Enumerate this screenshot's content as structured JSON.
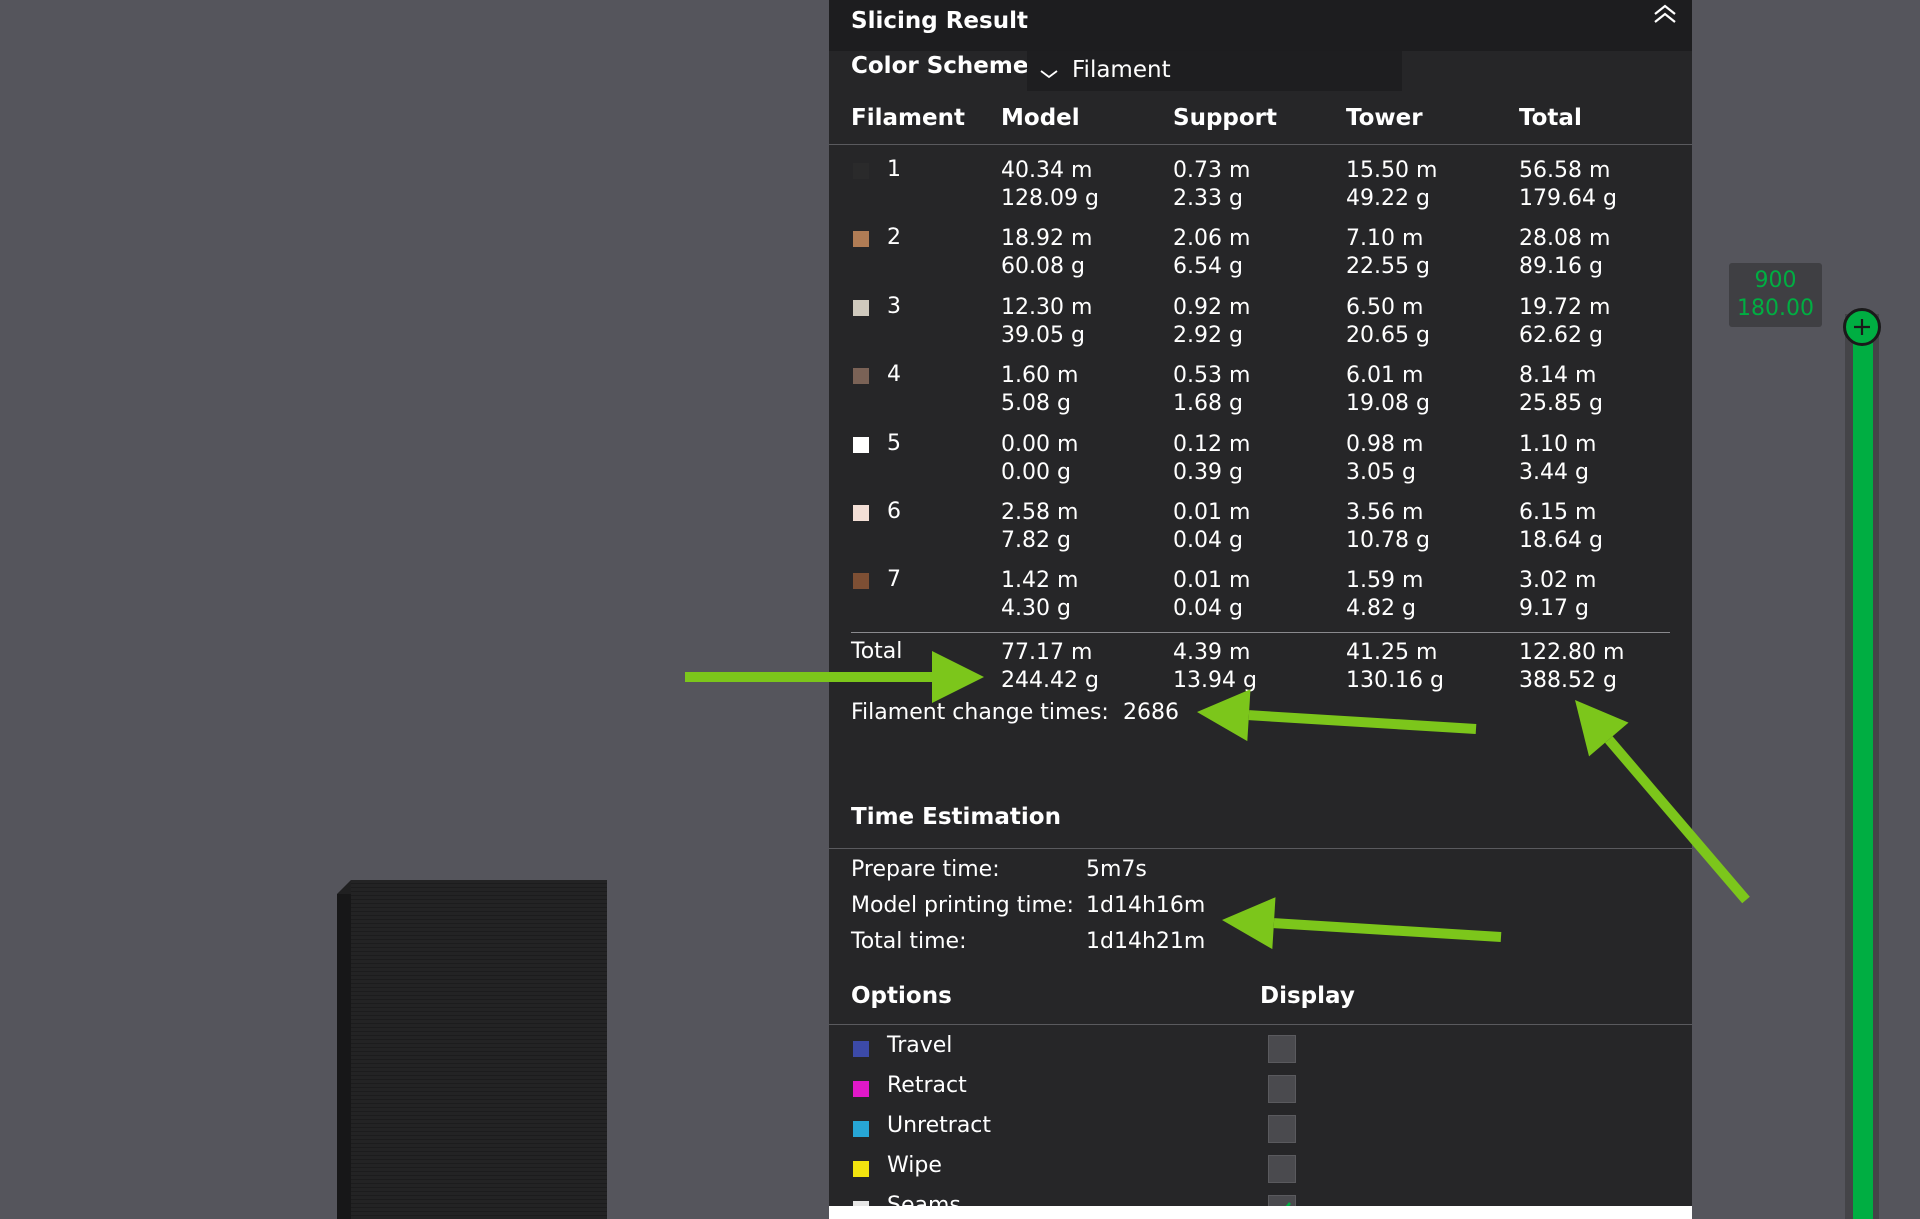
{
  "panel": {
    "title": "Slicing Result",
    "color_scheme_label": "Color Scheme",
    "color_scheme_value": "Filament"
  },
  "usage": {
    "headers": [
      "Filament",
      "Model",
      "Support",
      "Tower",
      "Total"
    ],
    "rows": [
      {
        "id": "1",
        "color": "#2a2a2b",
        "model": [
          "40.34 m",
          "128.09 g"
        ],
        "support": [
          "0.73 m",
          "2.33 g"
        ],
        "tower": [
          "15.50 m",
          "49.22 g"
        ],
        "total": [
          "56.58 m",
          "179.64 g"
        ]
      },
      {
        "id": "2",
        "color": "#b07c55",
        "model": [
          "18.92 m",
          "60.08 g"
        ],
        "support": [
          "2.06 m",
          "6.54 g"
        ],
        "tower": [
          "7.10 m",
          "22.55 g"
        ],
        "total": [
          "28.08 m",
          "89.16 g"
        ]
      },
      {
        "id": "3",
        "color": "#cfc9bd",
        "model": [
          "12.30 m",
          "39.05 g"
        ],
        "support": [
          "0.92 m",
          "2.92 g"
        ],
        "tower": [
          "6.50 m",
          "20.65 g"
        ],
        "total": [
          "19.72 m",
          "62.62 g"
        ]
      },
      {
        "id": "4",
        "color": "#7a6256",
        "model": [
          "1.60 m",
          "5.08 g"
        ],
        "support": [
          "0.53 m",
          "1.68 g"
        ],
        "tower": [
          "6.01 m",
          "19.08 g"
        ],
        "total": [
          "8.14 m",
          "25.85 g"
        ]
      },
      {
        "id": "5",
        "color": "#ffffff",
        "model": [
          "0.00 m",
          "0.00 g"
        ],
        "support": [
          "0.12 m",
          "0.39 g"
        ],
        "tower": [
          "0.98 m",
          "3.05 g"
        ],
        "total": [
          "1.10 m",
          "3.44 g"
        ]
      },
      {
        "id": "6",
        "color": "#f3dfd6",
        "model": [
          "2.58 m",
          "7.82 g"
        ],
        "support": [
          "0.01 m",
          "0.04 g"
        ],
        "tower": [
          "3.56 m",
          "10.78 g"
        ],
        "total": [
          "6.15 m",
          "18.64 g"
        ]
      },
      {
        "id": "7",
        "color": "#7d4f34",
        "model": [
          "1.42 m",
          "4.30 g"
        ],
        "support": [
          "0.01 m",
          "0.04 g"
        ],
        "tower": [
          "1.59 m",
          "4.82 g"
        ],
        "total": [
          "3.02 m",
          "9.17 g"
        ]
      }
    ],
    "total": {
      "label": "Total",
      "model": [
        "77.17 m",
        "244.42 g"
      ],
      "support": [
        "4.39 m",
        "13.94 g"
      ],
      "tower": [
        "41.25 m",
        "130.16 g"
      ],
      "total": [
        "122.80 m",
        "388.52 g"
      ]
    },
    "change_times_label": "Filament change times:",
    "change_times_value": "2686"
  },
  "time": {
    "header": "Time Estimation",
    "rows": [
      {
        "label": "Prepare time:",
        "value": "5m7s"
      },
      {
        "label": "Model printing time:",
        "value": "1d14h16m"
      },
      {
        "label": "Total time:",
        "value": "1d14h21m"
      }
    ]
  },
  "options": {
    "header_options": "Options",
    "header_display": "Display",
    "items": [
      {
        "name": "Travel",
        "color": "#3c4aa8",
        "checked": false
      },
      {
        "name": "Retract",
        "color": "#e018c8",
        "checked": false
      },
      {
        "name": "Unretract",
        "color": "#27a6d6",
        "checked": false
      },
      {
        "name": "Wipe",
        "color": "#f2e30f",
        "checked": false
      },
      {
        "name": "Seams",
        "color": "#e6e6e6",
        "checked": true
      }
    ]
  },
  "slider": {
    "layer": "900",
    "height": "180.00",
    "accent": "#00ae42"
  },
  "icons": [
    "collapse-double-chevron-up-icon",
    "chevron-down-icon",
    "plus-icon",
    "checkmark-icon"
  ],
  "annotation_color": "#7cc61b"
}
